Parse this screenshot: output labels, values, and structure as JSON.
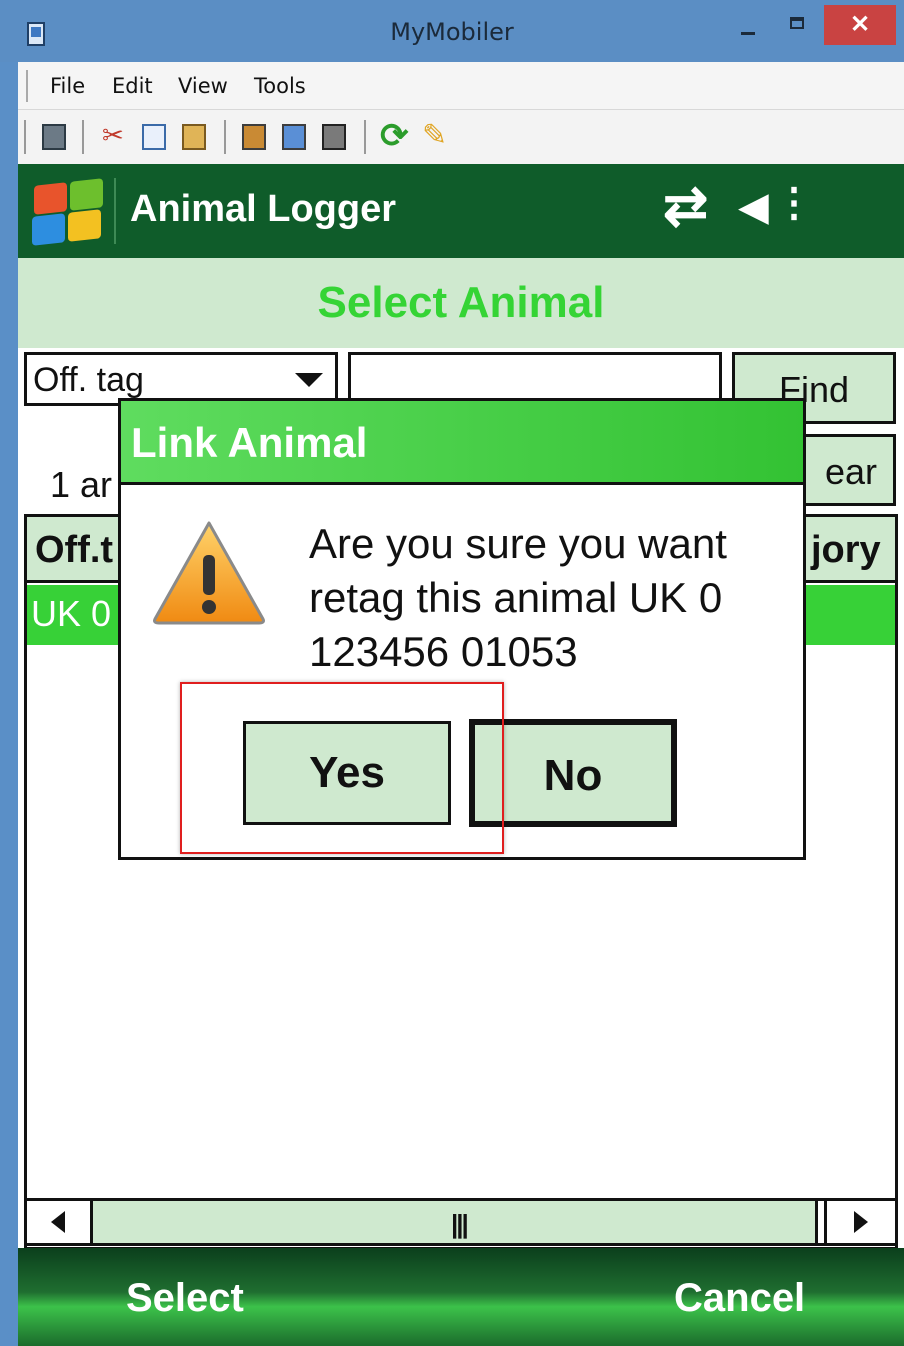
{
  "window": {
    "title": "MyMobiler",
    "icons": {
      "app": "mobile-device-icon",
      "minimize": "minimize-icon",
      "maximize": "maximize-icon",
      "close": "close-icon"
    },
    "close_glyph": "✕"
  },
  "menu": {
    "items": [
      "File",
      "Edit",
      "View",
      "Tools"
    ]
  },
  "toolbar": {
    "icons": [
      "device-icon",
      "cut-icon",
      "copy-icon",
      "paste-icon",
      "send-file-icon",
      "receive-file-icon",
      "screen-capture-icon",
      "refresh-icon",
      "clean-icon"
    ]
  },
  "app": {
    "title": "Animal Logger",
    "status_icons": [
      "connectivity-icon",
      "speaker-muted-icon"
    ],
    "section_title": "Select Animal",
    "search": {
      "field_selected": "Off. tag",
      "query": "",
      "find_label": "Find",
      "clear_label": "ear"
    },
    "result_count": "1 ar",
    "table": {
      "columns": [
        "Off.t",
        "jory"
      ],
      "rows": [
        {
          "tag": "UK 0"
        }
      ]
    },
    "scrollbar": {
      "thumb": "|||"
    },
    "softkeys": {
      "left": "Select",
      "right": "Cancel"
    }
  },
  "dialog": {
    "title": "Link Animal",
    "icon": "warning-icon",
    "message": "Are you sure you want retag this animal UK 0 123456 01053",
    "yes_label": "Yes",
    "no_label": "No"
  },
  "colors": {
    "window_frame": "#5b8ec4",
    "app_header": "#0f5c2a",
    "light_green": "#cfe9cf",
    "accent_green": "#35d435",
    "highlight_red": "#e01e1e",
    "close_red": "#c94342"
  }
}
